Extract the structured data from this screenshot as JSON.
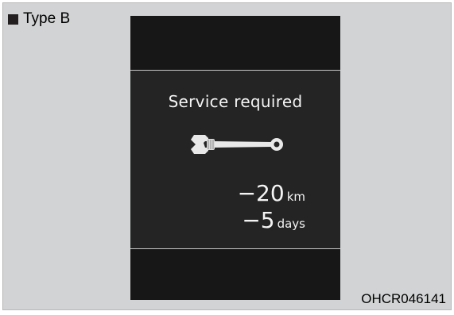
{
  "header": {
    "type_label": "Type B"
  },
  "display": {
    "title": "Service required",
    "icon": "wrench-icon",
    "distance": {
      "value": "−20",
      "unit": "km"
    },
    "time": {
      "value": "−5",
      "unit": "days"
    }
  },
  "caption": "OHCR046141",
  "colors": {
    "background": "#d1d3d4",
    "screen": "#242424",
    "text": "#f4f4f4"
  }
}
